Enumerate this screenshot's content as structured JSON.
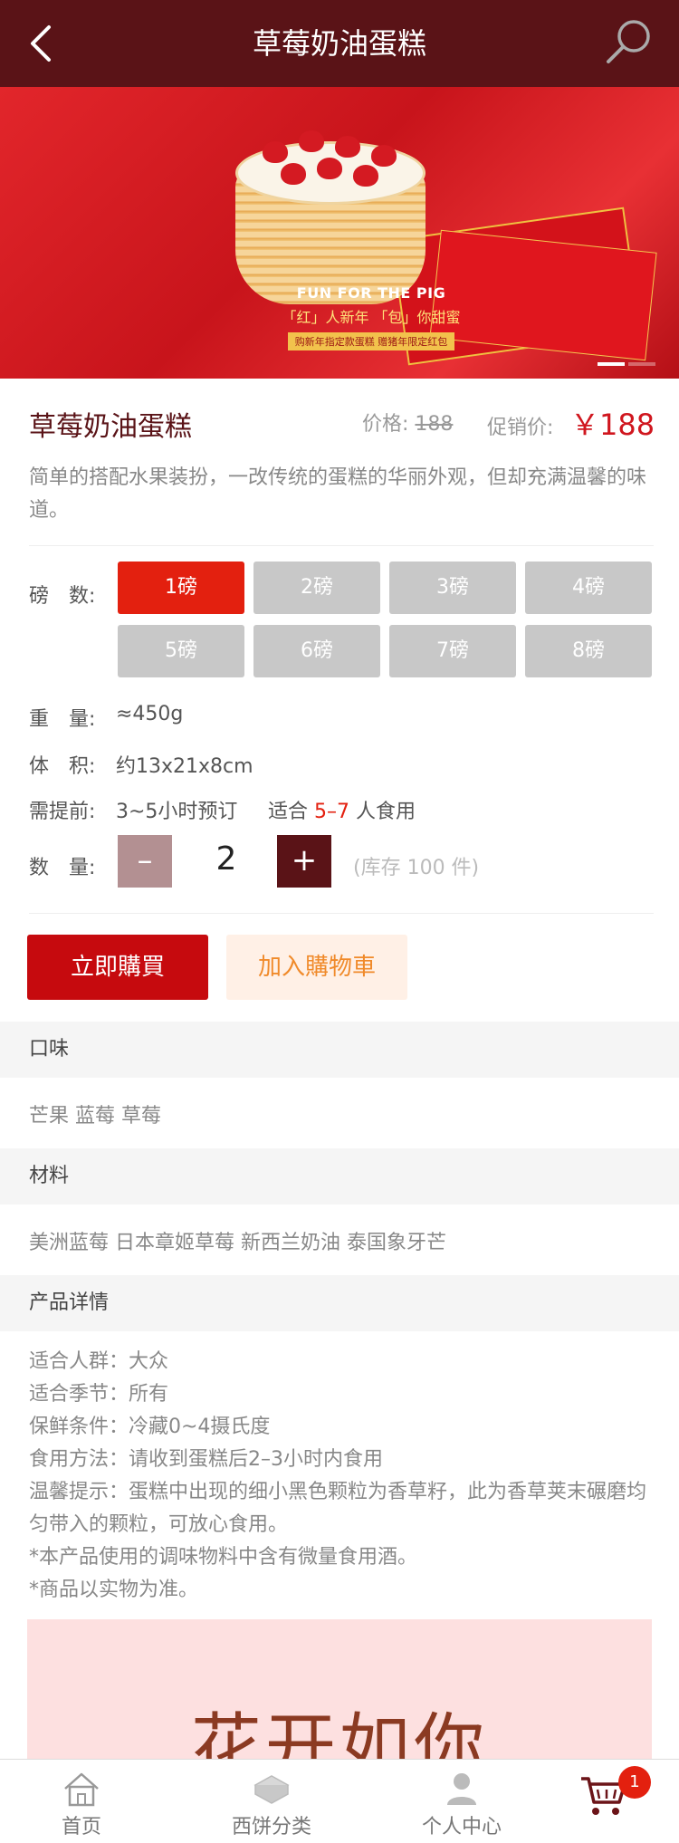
{
  "header": {
    "title": "草莓奶油蛋糕"
  },
  "banner": {
    "headline_en": "FUN FOR THE PIG",
    "headline_cn": "「红」人新年 「包」你甜蜜",
    "strip": "购新年指定款蛋糕 赠猪年限定红包"
  },
  "product": {
    "name": "草莓奶油蛋糕",
    "old_price_label": "价格:",
    "old_price": "188",
    "sale_price_label": "促销价:",
    "sale_price": "￥188",
    "description": "简单的搭配水果装扮，一改传统的蛋糕的华丽外观，但却充满温馨的味道。"
  },
  "specs": {
    "pound_label": "磅　数:",
    "pound_options": [
      "1磅",
      "2磅",
      "3磅",
      "4磅",
      "5磅",
      "6磅",
      "7磅",
      "8磅"
    ],
    "selected_index": 0,
    "weight_label": "重　量:",
    "weight_value": "≈450g",
    "volume_label": "体　积:",
    "volume_value": "约13x21x8cm",
    "advance_label": "需提前:",
    "advance_value": "3~5小时预订",
    "serve_prefix": "适合",
    "serve_range": "5–7",
    "serve_suffix": "人食用",
    "qty_label": "数　量:",
    "qty_minus": "–",
    "qty_value": "2",
    "qty_plus": "+",
    "stock": "(库存 100 件)"
  },
  "actions": {
    "buy_now": "立即購買",
    "add_cart": "加入購物車"
  },
  "sections": {
    "flavor_title": "口味",
    "flavor_body": "芒果 蓝莓 草莓",
    "material_title": "材料",
    "material_body": "美洲蓝莓 日本章姬草莓 新西兰奶油 泰国象牙芒",
    "detail_title": "产品详情",
    "detail_lines": [
      "适合人群：大众",
      "适合季节：所有",
      "保鲜条件：冷藏0~4摄氏度",
      "食用方法：请收到蛋糕后2–3小时内食用",
      "温馨提示：蛋糕中出现的细小黑色颗粒为香草籽，此为香草荚末碾磨均匀带入的颗粒，可放心食用。",
      "*本产品使用的调味物料中含有微量食用酒。",
      "*商品以实物为准。"
    ]
  },
  "promo": {
    "text": "花开如你"
  },
  "tabbar": {
    "home": "首页",
    "category": "西饼分类",
    "profile": "个人中心",
    "cart_badge": "1"
  },
  "colors": {
    "header_bg": "#5a1317",
    "accent_red": "#e3200f",
    "price_red": "#d0161e"
  }
}
